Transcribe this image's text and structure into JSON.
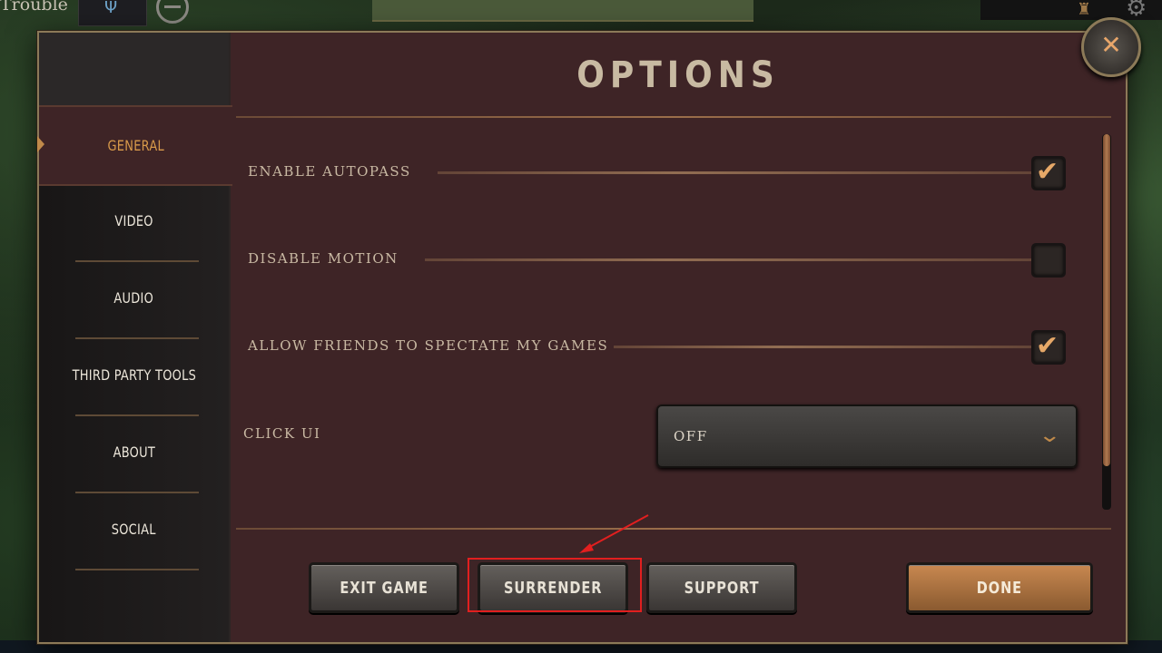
{
  "background": {
    "top_left_text": "Trouble"
  },
  "dialog": {
    "title": "OPTIONS",
    "sidebar": [
      {
        "label": "GENERAL",
        "active": true
      },
      {
        "label": "VIDEO",
        "active": false
      },
      {
        "label": "AUDIO",
        "active": false
      },
      {
        "label": "THIRD PARTY TOOLS",
        "active": false
      },
      {
        "label": "ABOUT",
        "active": false
      },
      {
        "label": "SOCIAL",
        "active": false
      }
    ],
    "settings": [
      {
        "label": "ENABLE AUTOPASS",
        "checked": true
      },
      {
        "label": "DISABLE MOTION",
        "checked": false
      },
      {
        "label": "ALLOW FRIENDS TO SPECTATE MY GAMES",
        "checked": true
      }
    ],
    "click_ui": {
      "label": "CLICK UI",
      "value": "OFF"
    },
    "buttons": {
      "exit_game": "EXIT GAME",
      "surrender": "SURRENDER",
      "support": "SUPPORT",
      "done": "DONE"
    },
    "colors": {
      "panel": "#3e2426",
      "accent": "#d89a4a",
      "highlight": "#e21f1f"
    }
  }
}
